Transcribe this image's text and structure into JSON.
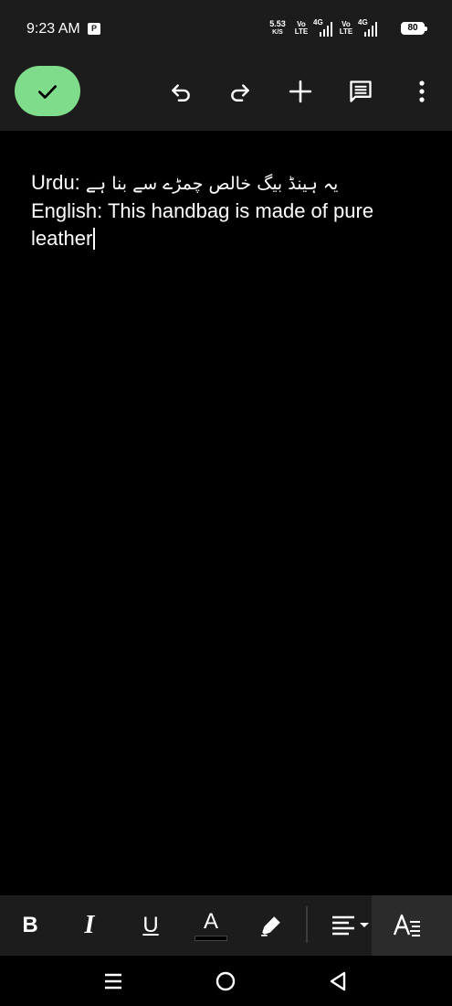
{
  "status_bar": {
    "time": "9:23 AM",
    "app_icon": "P",
    "net_speed_value": "5.53",
    "net_speed_unit": "K/S",
    "sim1": {
      "volte_line1": "Vo",
      "volte_line2": "LTE",
      "network": "4G"
    },
    "sim2": {
      "volte_line1": "Vo",
      "volte_line2": "LTE",
      "network": "4G"
    },
    "battery": "80"
  },
  "toolbar": {
    "done_icon": "checkmark-icon",
    "undo_icon": "undo-icon",
    "redo_icon": "redo-icon",
    "add_icon": "plus-icon",
    "comment_icon": "comment-icon",
    "more_icon": "more-vertical-icon",
    "done_color": "#7fdc8a"
  },
  "document": {
    "urdu_label": "Urdu:",
    "urdu_text": "یہ ہینڈ بیگ خالص چمڑے سے بنا ہے",
    "english_line1": "English: This handbag is made of pure",
    "english_line2": "leather"
  },
  "format_bar": {
    "bold_label": "B",
    "italic_label": "I",
    "underline_label": "U",
    "text_color_label": "A",
    "highlight_icon": "highlighter-icon",
    "align_icon": "align-left-icon",
    "text_style_icon": "text-style-icon"
  },
  "nav_bar": {
    "recents_icon": "menu-icon",
    "home_icon": "home-circle-icon",
    "back_icon": "back-triangle-icon"
  }
}
